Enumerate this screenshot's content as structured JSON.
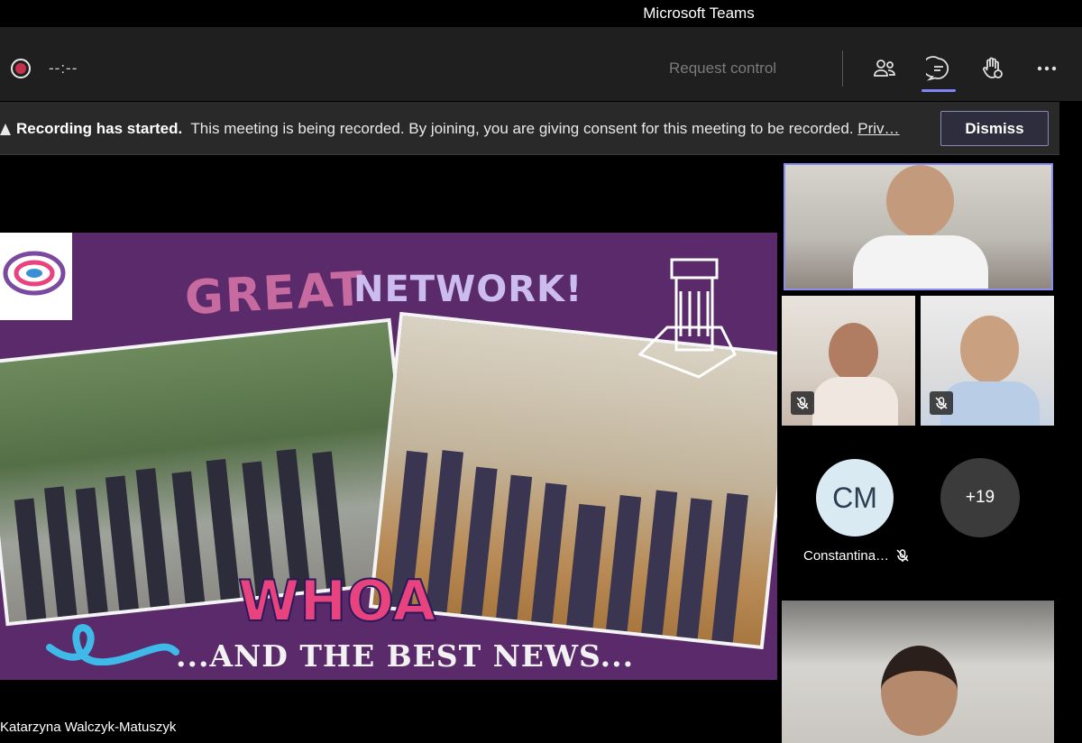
{
  "window": {
    "title": "Microsoft Teams"
  },
  "toolbar": {
    "timer": "--:--",
    "request_control": "Request control",
    "icons": [
      "record-icon",
      "people-icon",
      "chat-icon",
      "raise-hand-icon",
      "more-icon"
    ]
  },
  "banner": {
    "bold": "Recording has started.",
    "message": "This meeting is being recorded. By joining, you are giving consent for this meeting to be recorded.",
    "link": "Priv…",
    "dismiss": "Dismiss"
  },
  "stage": {
    "presenter": "Katarzyna Walczyk-Matuszyk",
    "slide": {
      "heading_great": "GREAT",
      "heading_network": "NETWORK!",
      "exclaim": "WHOA",
      "footer": "...AND THE BEST NEWS..."
    }
  },
  "participants": {
    "avatar_initials": "CM",
    "avatar_name": "Constantina…",
    "more_count": "+19"
  },
  "colors": {
    "accent": "#7f85f5",
    "record": "#c4314b",
    "slide_bg": "#5a2a6b"
  }
}
